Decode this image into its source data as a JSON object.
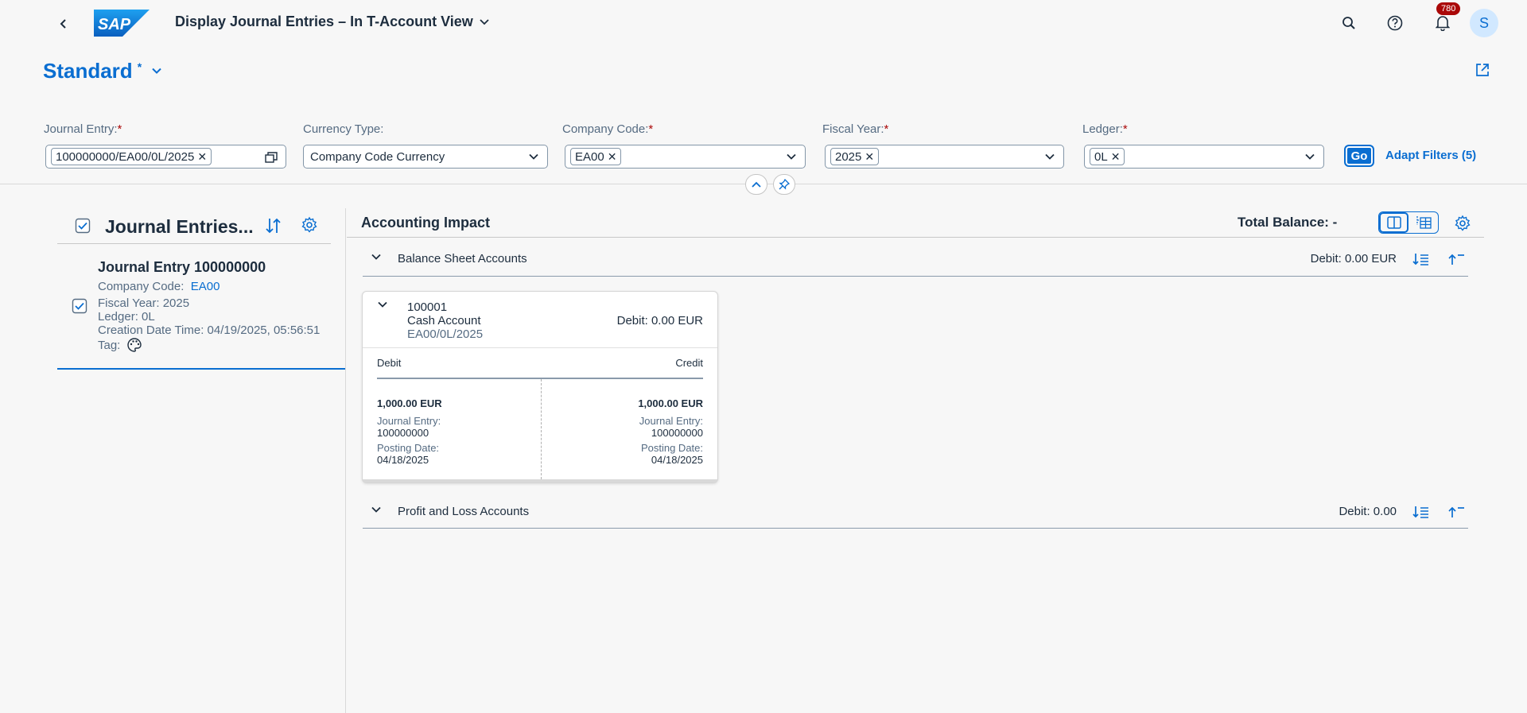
{
  "shell": {
    "title": "Display Journal Entries – In T-Account View",
    "notifications_count": "780",
    "avatar_initial": "S",
    "logo_text": "SAP"
  },
  "variant": {
    "name": "Standard",
    "modified_marker": "*"
  },
  "filters": {
    "journal_entry": {
      "label": "Journal Entry:",
      "token": "100000000/EA00/0L/2025"
    },
    "currency_type": {
      "label": "Currency Type:",
      "value": "Company Code Currency"
    },
    "company_code": {
      "label": "Company Code:",
      "token": "EA00"
    },
    "fiscal_year": {
      "label": "Fiscal Year:",
      "token": "2025"
    },
    "ledger": {
      "label": "Ledger:",
      "token": "0L"
    },
    "required_marker": "*",
    "go_label": "Go",
    "adapt_label": "Adapt Filters (5)"
  },
  "left_panel": {
    "title": "Journal Entries...",
    "entry": {
      "title": "Journal Entry 100000000",
      "company_code_label": "Company Code:",
      "company_code_value": "EA00",
      "fiscal_year": "Fiscal Year: 2025",
      "ledger": "Ledger: 0L",
      "creation": "Creation Date Time: 04/19/2025, 05:56:51",
      "tag_label": "Tag:"
    }
  },
  "right_panel": {
    "title": "Accounting Impact",
    "total_balance": "Total Balance: -",
    "sections": [
      {
        "label": "Balance Sheet Accounts",
        "debit": "Debit: 0.00 EUR"
      },
      {
        "label": "Profit and Loss Accounts",
        "debit": "Debit: 0.00"
      }
    ],
    "card": {
      "account_no": "100001",
      "account_name": "Cash Account",
      "account_path": "EA00/0L/2025",
      "debit_summary": "Debit: 0.00 EUR",
      "debit_header": "Debit",
      "credit_header": "Credit",
      "debit": {
        "amount": "1,000.00 EUR",
        "je_label": "Journal Entry:",
        "je_value": "100000000",
        "pd_label": "Posting Date:",
        "pd_value": "04/18/2025"
      },
      "credit": {
        "amount": "1,000.00 EUR",
        "je_label": "Journal Entry:",
        "je_value": "100000000",
        "pd_label": "Posting Date:",
        "pd_value": "04/18/2025"
      }
    }
  },
  "colors": {
    "brand_blue": "#0a6ed1",
    "required": "#aa0808",
    "badge": "#aa0808",
    "text": "#1d2d3e",
    "muted": "#556b82"
  }
}
